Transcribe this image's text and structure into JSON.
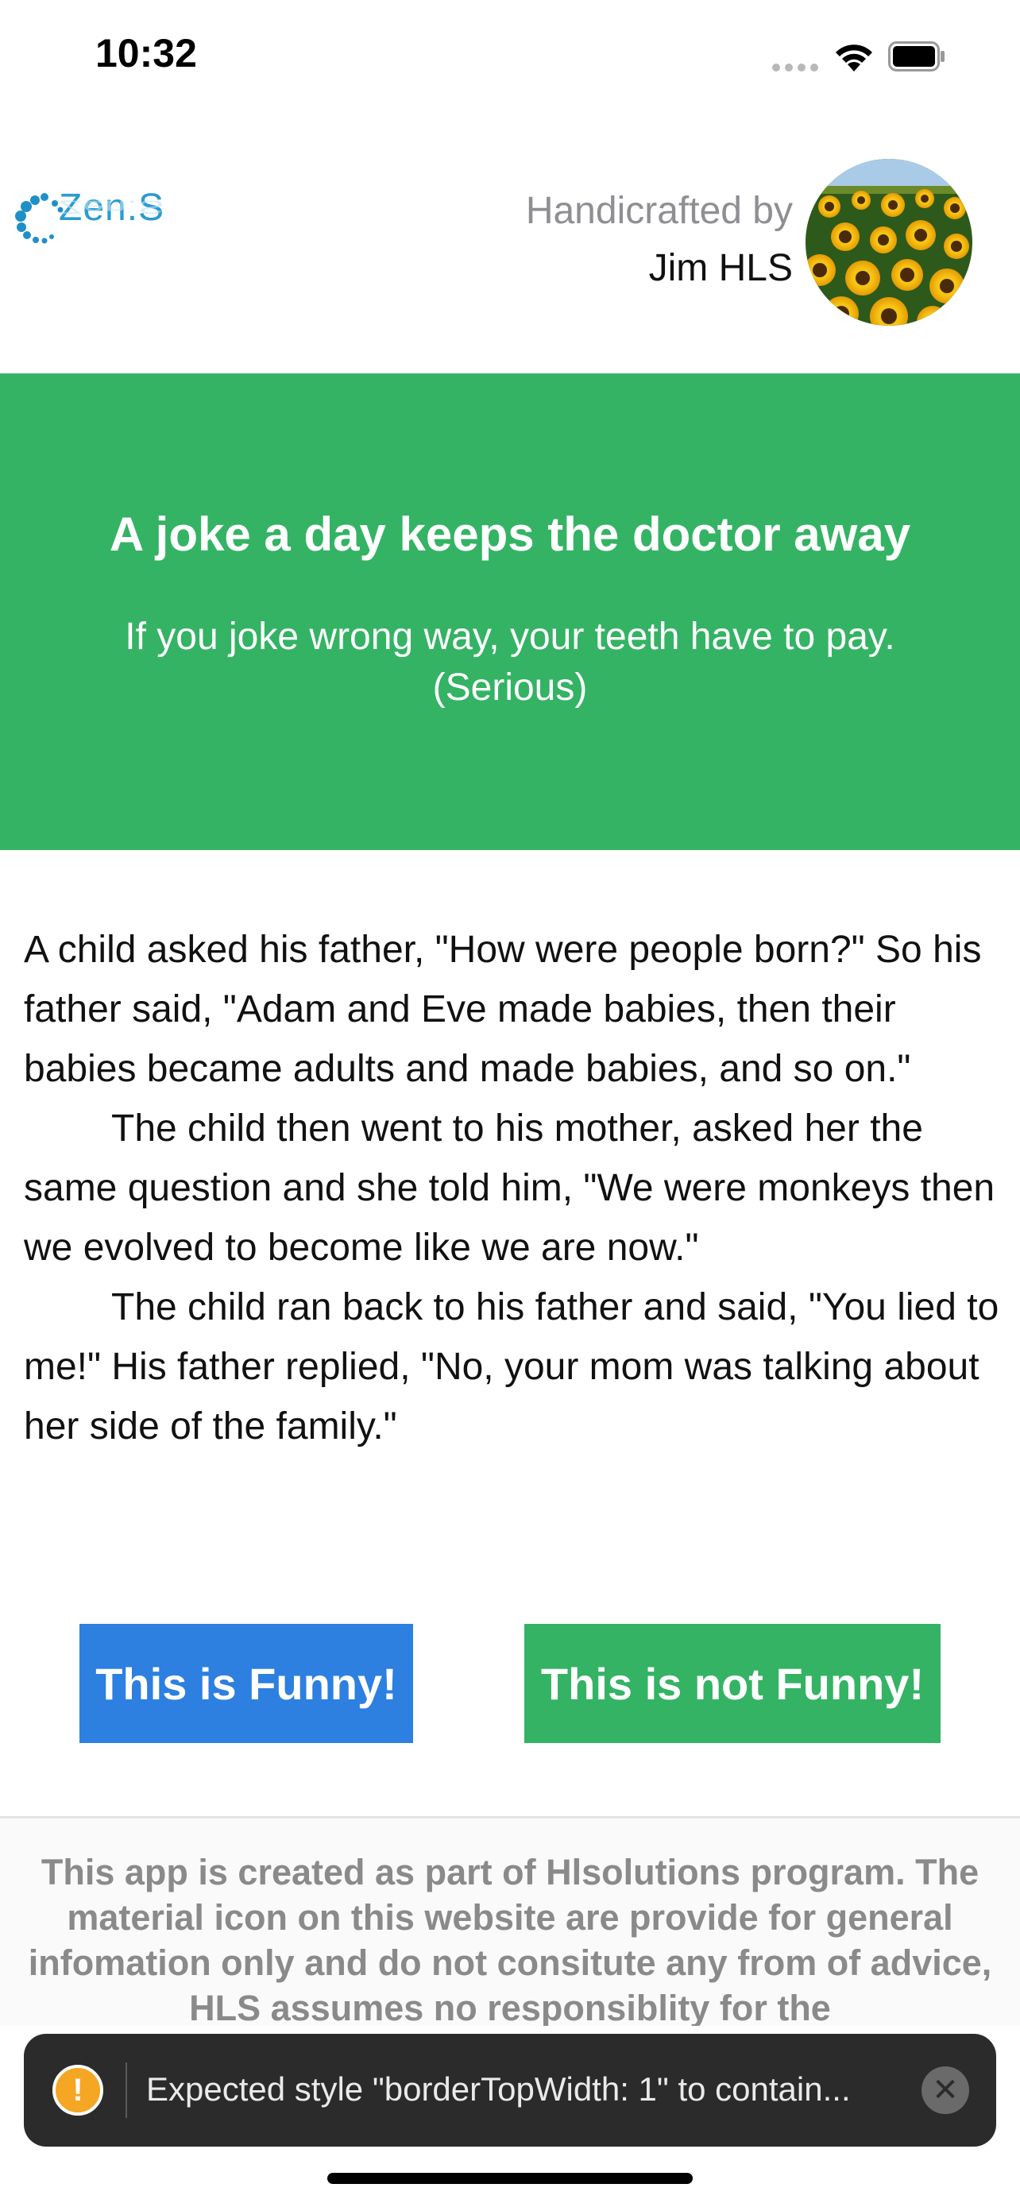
{
  "status_bar": {
    "time": "10:32"
  },
  "header": {
    "logo_text": "Zen.S",
    "crafted_label": "Handicrafted by",
    "crafted_name": "Jim HLS",
    "avatar_icon": "sunflower-avatar"
  },
  "banner": {
    "title": "A joke a day keeps the doctor away",
    "subtitle": "If you joke wrong way, your teeth have to pay. (Serious)",
    "background": "#34b364"
  },
  "joke": {
    "paragraphs": [
      "A child asked his father, \"How were people born?\" So his father said, \"Adam and Eve made babies, then their babies became adults and made babies, and so on.\"",
      "The child then went to his mother, asked her the same question and she told him, \"We were monkeys then we evolved to become like we are now.\"",
      "The child ran back to his father and said, \"You lied to me!\" His father replied, \"No, your mom was talking about her side of the family.\""
    ]
  },
  "buttons": {
    "funny_label": "This is Funny!",
    "funny_color": "#2d7fe0",
    "not_funny_label": "This is not Funny!",
    "not_funny_color": "#34b364"
  },
  "footer": {
    "text": "This app is created as part of Hlsolutions program. The material icon on this website are provide for general infomation only and do not consitute any from of advice, HLS assumes no responsiblity for the"
  },
  "toast": {
    "icon": "warning-icon",
    "message": "Expected style \"borderTopWidth: 1\" to contain...",
    "close_icon": "close-icon"
  }
}
